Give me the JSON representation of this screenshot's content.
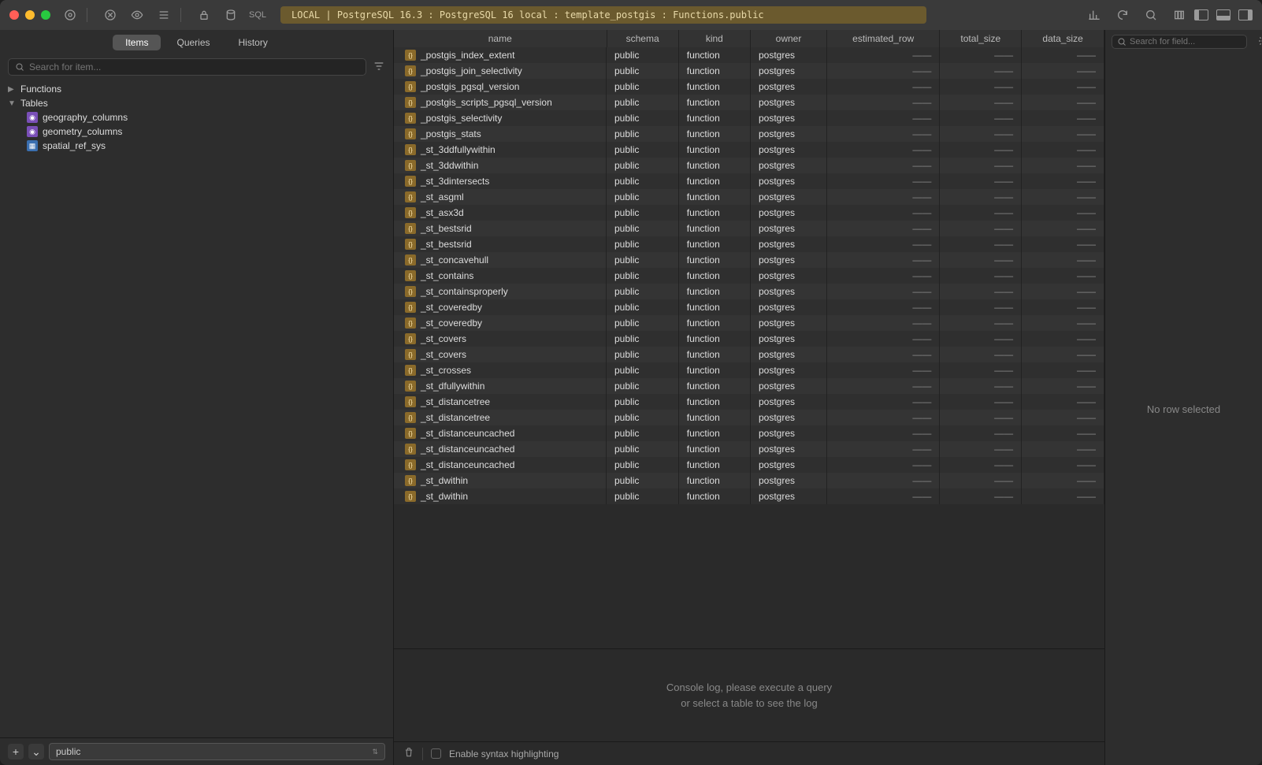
{
  "titlebar": {
    "sql_label": "SQL",
    "breadcrumb": "LOCAL | PostgreSQL 16.3 : PostgreSQL 16 local : template_postgis : Functions.public"
  },
  "sidebar": {
    "tabs": {
      "items": "Items",
      "queries": "Queries",
      "history": "History"
    },
    "search_placeholder": "Search for item...",
    "tree": {
      "functions": "Functions",
      "tables": "Tables",
      "children": [
        {
          "label": "geography_columns",
          "kind": "view"
        },
        {
          "label": "geometry_columns",
          "kind": "view"
        },
        {
          "label": "spatial_ref_sys",
          "kind": "table"
        }
      ]
    },
    "footer": {
      "schema": "public"
    }
  },
  "grid": {
    "headers": {
      "name": "name",
      "schema": "schema",
      "kind": "kind",
      "owner": "owner",
      "estimated_row": "estimated_row",
      "total_size": "total_size",
      "data_size": "data_size"
    },
    "dash": "——",
    "rows": [
      {
        "name": "_postgis_index_extent",
        "schema": "public",
        "kind": "function",
        "owner": "postgres"
      },
      {
        "name": "_postgis_join_selectivity",
        "schema": "public",
        "kind": "function",
        "owner": "postgres"
      },
      {
        "name": "_postgis_pgsql_version",
        "schema": "public",
        "kind": "function",
        "owner": "postgres"
      },
      {
        "name": "_postgis_scripts_pgsql_version",
        "schema": "public",
        "kind": "function",
        "owner": "postgres"
      },
      {
        "name": "_postgis_selectivity",
        "schema": "public",
        "kind": "function",
        "owner": "postgres"
      },
      {
        "name": "_postgis_stats",
        "schema": "public",
        "kind": "function",
        "owner": "postgres"
      },
      {
        "name": "_st_3ddfullywithin",
        "schema": "public",
        "kind": "function",
        "owner": "postgres"
      },
      {
        "name": "_st_3ddwithin",
        "schema": "public",
        "kind": "function",
        "owner": "postgres"
      },
      {
        "name": "_st_3dintersects",
        "schema": "public",
        "kind": "function",
        "owner": "postgres"
      },
      {
        "name": "_st_asgml",
        "schema": "public",
        "kind": "function",
        "owner": "postgres"
      },
      {
        "name": "_st_asx3d",
        "schema": "public",
        "kind": "function",
        "owner": "postgres"
      },
      {
        "name": "_st_bestsrid",
        "schema": "public",
        "kind": "function",
        "owner": "postgres"
      },
      {
        "name": "_st_bestsrid",
        "schema": "public",
        "kind": "function",
        "owner": "postgres"
      },
      {
        "name": "_st_concavehull",
        "schema": "public",
        "kind": "function",
        "owner": "postgres"
      },
      {
        "name": "_st_contains",
        "schema": "public",
        "kind": "function",
        "owner": "postgres"
      },
      {
        "name": "_st_containsproperly",
        "schema": "public",
        "kind": "function",
        "owner": "postgres"
      },
      {
        "name": "_st_coveredby",
        "schema": "public",
        "kind": "function",
        "owner": "postgres"
      },
      {
        "name": "_st_coveredby",
        "schema": "public",
        "kind": "function",
        "owner": "postgres"
      },
      {
        "name": "_st_covers",
        "schema": "public",
        "kind": "function",
        "owner": "postgres"
      },
      {
        "name": "_st_covers",
        "schema": "public",
        "kind": "function",
        "owner": "postgres"
      },
      {
        "name": "_st_crosses",
        "schema": "public",
        "kind": "function",
        "owner": "postgres"
      },
      {
        "name": "_st_dfullywithin",
        "schema": "public",
        "kind": "function",
        "owner": "postgres"
      },
      {
        "name": "_st_distancetree",
        "schema": "public",
        "kind": "function",
        "owner": "postgres"
      },
      {
        "name": "_st_distancetree",
        "schema": "public",
        "kind": "function",
        "owner": "postgres"
      },
      {
        "name": "_st_distanceuncached",
        "schema": "public",
        "kind": "function",
        "owner": "postgres"
      },
      {
        "name": "_st_distanceuncached",
        "schema": "public",
        "kind": "function",
        "owner": "postgres"
      },
      {
        "name": "_st_distanceuncached",
        "schema": "public",
        "kind": "function",
        "owner": "postgres"
      },
      {
        "name": "_st_dwithin",
        "schema": "public",
        "kind": "function",
        "owner": "postgres"
      },
      {
        "name": "_st_dwithin",
        "schema": "public",
        "kind": "function",
        "owner": "postgres"
      }
    ]
  },
  "console": {
    "line1": "Console log, please execute a query",
    "line2": "or select a table to see the log"
  },
  "footer": {
    "syntax_label": "Enable syntax highlighting"
  },
  "inspector": {
    "search_placeholder": "Search for field...",
    "empty": "No row selected"
  }
}
